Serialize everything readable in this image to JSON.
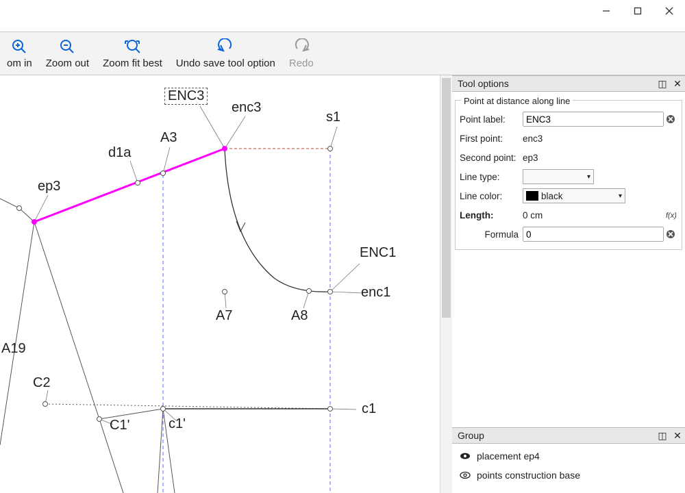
{
  "toolbar": {
    "zoom_in": "om in",
    "zoom_out": "Zoom out",
    "zoom_fit": "Zoom fit best",
    "undo": "Undo save tool option",
    "redo": "Redo"
  },
  "tool_options": {
    "panel_title": "Tool options",
    "legend": "Point at distance along line",
    "point_label_lbl": "Point label:",
    "point_label_val": "ENC3",
    "first_point_lbl": "First point:",
    "first_point_val": "enc3",
    "second_point_lbl": "Second point:",
    "second_point_val": "ep3",
    "line_type_lbl": "Line type:",
    "line_type_val": "",
    "line_color_lbl": "Line color:",
    "line_color_val": "black",
    "line_color_hex": "#000000",
    "length_lbl": "Length:",
    "length_val": "0 cm",
    "formula_lbl": "Formula",
    "formula_val": "0"
  },
  "group_panel": {
    "panel_title": "Group",
    "rows": [
      {
        "label": "placement ep4",
        "visible": true
      },
      {
        "label": "points construction base",
        "visible": true
      }
    ]
  },
  "canvas_labels": {
    "ENC3": "ENC3",
    "enc3": "enc3",
    "s1": "s1",
    "A3": "A3",
    "d1a": "d1a",
    "ep3": "ep3",
    "ENC1": "ENC1",
    "enc1": "enc1",
    "A7": "A7",
    "A8": "A8",
    "A19": "A19",
    "C2": "C2",
    "C1p": "C1'",
    "c1p": "c1'",
    "c1": "c1"
  }
}
